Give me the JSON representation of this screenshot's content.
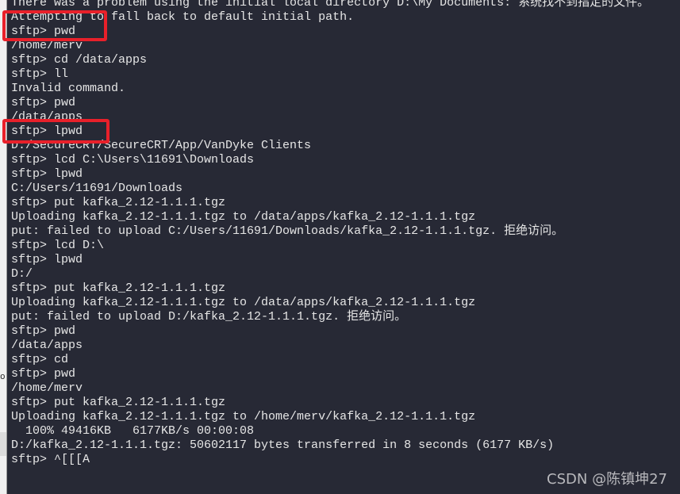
{
  "terminal": {
    "lines": [
      "There was a problem using the initial local directory D:\\My Documents: 系统找不到指定的文件。",
      "Attempting to fall back to default initial path.",
      "sftp> pwd",
      "/home/merv",
      "sftp> cd /data/apps",
      "sftp> ll",
      "Invalid command.",
      "sftp> pwd",
      "/data/apps",
      "sftp> lpwd",
      "D:/SecureCRT/SecureCRT/App/VanDyke Clients",
      "sftp> lcd C:\\Users\\11691\\Downloads",
      "sftp> lpwd",
      "C:/Users/11691/Downloads",
      "sftp> put kafka_2.12-1.1.1.tgz",
      "Uploading kafka_2.12-1.1.1.tgz to /data/apps/kafka_2.12-1.1.1.tgz",
      "put: failed to upload C:/Users/11691/Downloads/kafka_2.12-1.1.1.tgz. 拒绝访问。",
      "sftp> lcd D:\\",
      "sftp> lpwd",
      "D:/",
      "sftp> put kafka_2.12-1.1.1.tgz",
      "Uploading kafka_2.12-1.1.1.tgz to /data/apps/kafka_2.12-1.1.1.tgz",
      "put: failed to upload D:/kafka_2.12-1.1.1.tgz. 拒绝访问。",
      "sftp> pwd",
      "/data/apps",
      "sftp> cd",
      "sftp> pwd",
      "/home/merv",
      "sftp> put kafka_2.12-1.1.1.tgz",
      "Uploading kafka_2.12-1.1.1.tgz to /home/merv/kafka_2.12-1.1.1.tgz",
      "  100% 49416KB   6177KB/s 00:00:08",
      "D:/kafka_2.12-1.1.1.tgz: 50602117 bytes transferred in 8 seconds (6177 KB/s)",
      "sftp> ^[[[A"
    ]
  },
  "highlight_color": "#e8202a",
  "watermark": "CSDN @陈镇坤27",
  "side_mark": "o"
}
